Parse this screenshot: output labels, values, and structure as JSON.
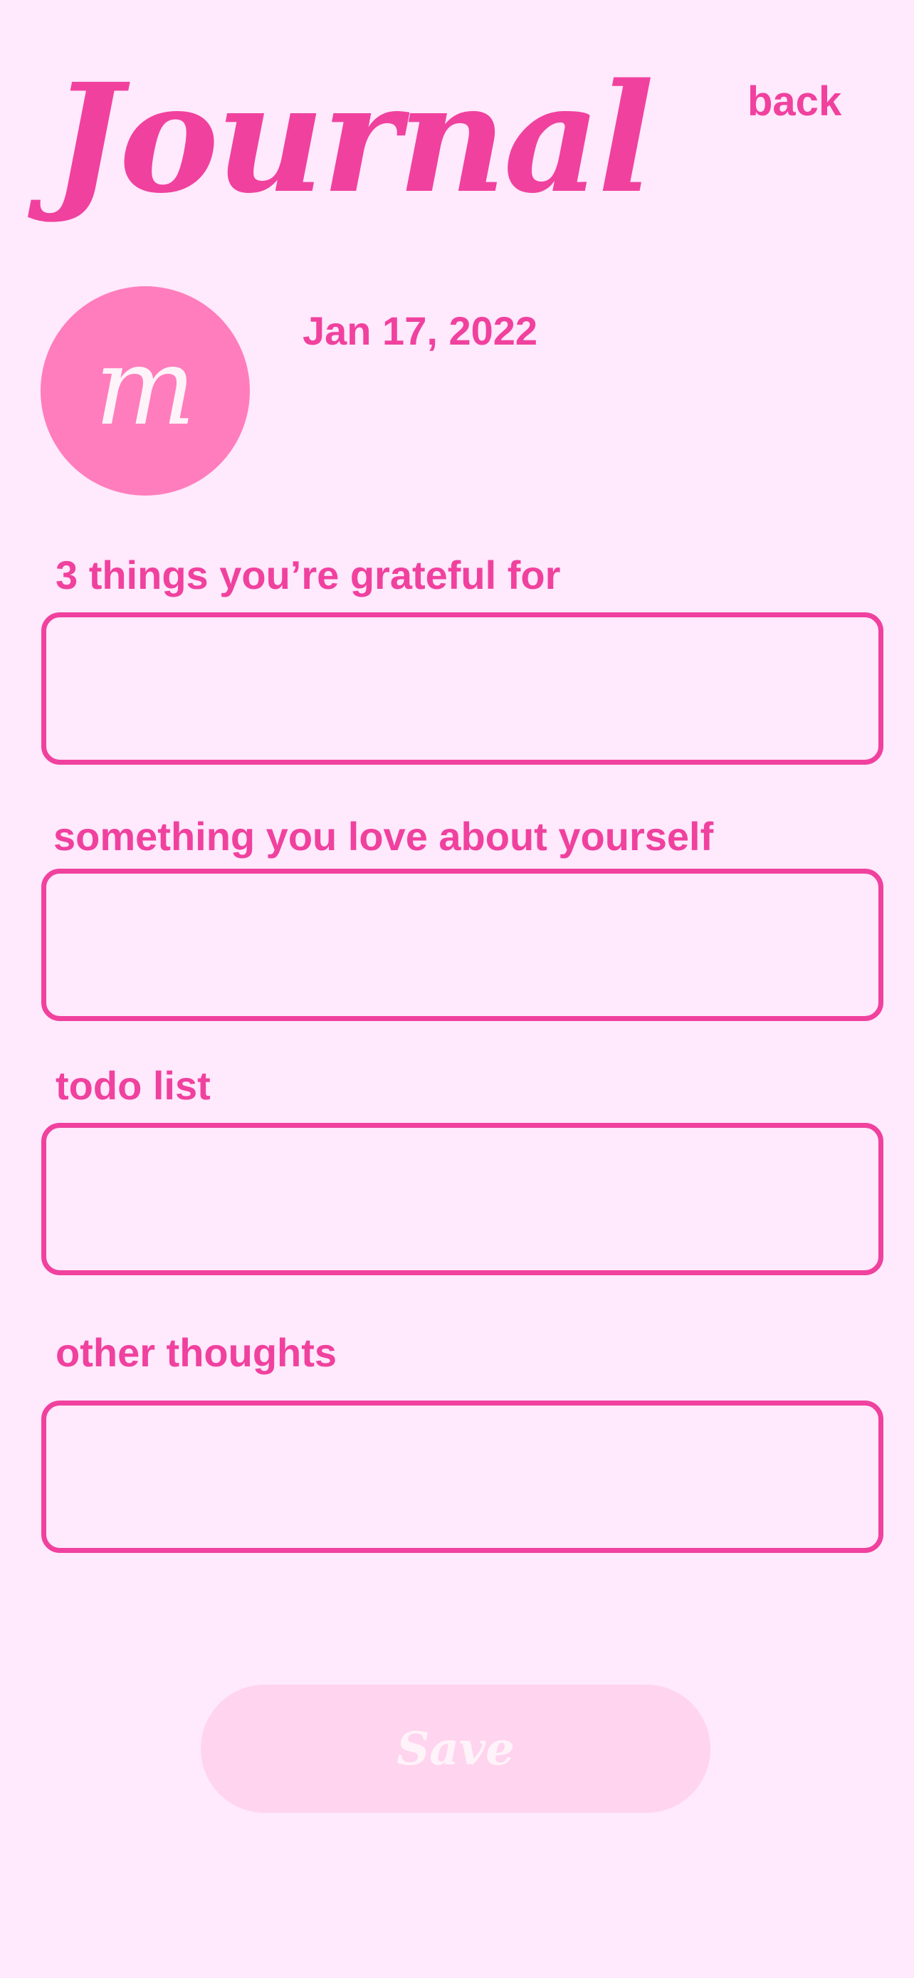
{
  "header": {
    "title": "Journal",
    "back_label": "back"
  },
  "profile": {
    "avatar_initial": "m",
    "date": "Jan 17, 2022"
  },
  "fields": [
    {
      "label": "3 things you’re grateful for",
      "value": ""
    },
    {
      "label": "something you love about yourself",
      "value": ""
    },
    {
      "label": "todo list",
      "value": ""
    },
    {
      "label": "other thoughts",
      "value": ""
    }
  ],
  "save_label": "Save",
  "colors": {
    "background": "#FFE9FD",
    "accent": "#F0419E",
    "avatar": "#FF7DBC",
    "save_button": "#FFD4EE"
  }
}
